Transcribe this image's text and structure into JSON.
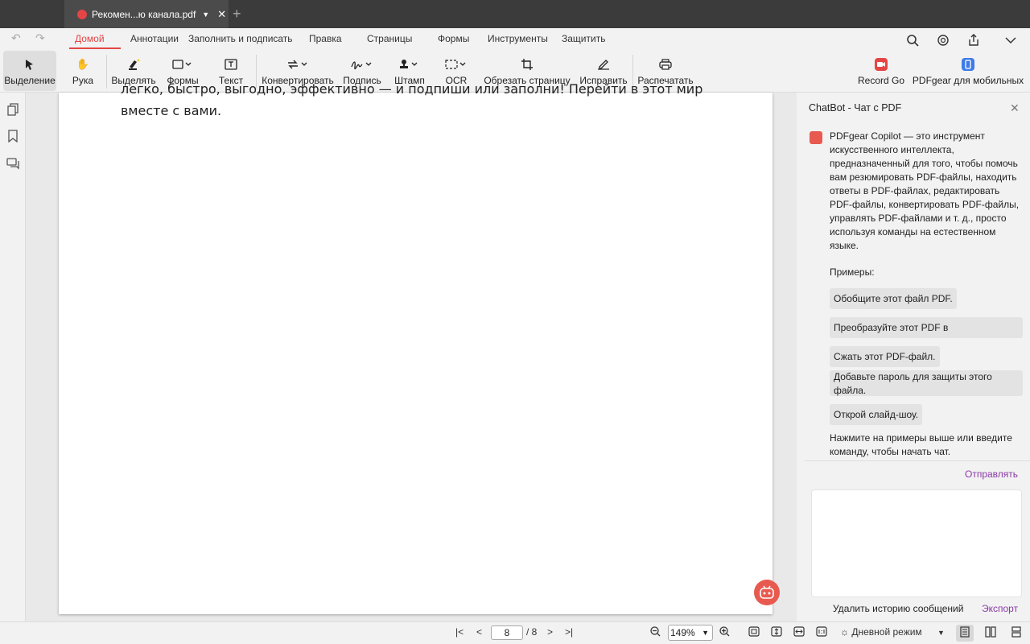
{
  "tab": {
    "title": "Рекомен...ю канала.pdf"
  },
  "menu": {
    "home": "Домой",
    "annotations": "Аннотации",
    "fill_sign": "Заполнить и подписать",
    "edit": "Правка",
    "pages": "Страницы",
    "forms": "Формы",
    "tools": "Инструменты",
    "protect": "Защитить"
  },
  "toolbar": {
    "select": "Выделение",
    "hand": "Рука",
    "highlight": "Выделять",
    "shapes": "Формы",
    "text": "Текст",
    "convert": "Конвертировать",
    "signature": "Подпись",
    "stamp": "Штамп",
    "ocr": "OCR",
    "crop": "Обрезать страницу",
    "fix": "Исправить",
    "print": "Распечатать",
    "record": "Record Go",
    "mobile": "PDFgear для мобильных"
  },
  "document": {
    "line_partial": "легко, быстро, выгодно, эффективно — и подпиши или заполни! Перейти в этот мир",
    "line_last": "вместе с вами."
  },
  "chat": {
    "title": "ChatBot - Чат с PDF",
    "intro": "PDFgear Copilot — это инструмент искусственного интеллекта, предназначенный для того, чтобы помочь вам резюмировать PDF-файлы, находить ответы в PDF-файлах, редактировать PDF-файлы, конвертировать PDF-файлы, управлять PDF-файлами и т. д., просто используя команды на естественном языке.",
    "examples_label": "Примеры:",
    "examples": [
      "Обобщите этот файл PDF.",
      "Преобразуйте этот PDF в",
      "Сжать этот PDF-файл.",
      "Добавьте пароль для защиты этого файла.",
      "Открой слайд-шоу."
    ],
    "hint": "Нажмите на примеры выше или введите команду, чтобы начать чат.",
    "send": "Отправлять",
    "clear_history": "Удалить историю сообщений",
    "export": "Экспорт"
  },
  "status": {
    "page_current": "8",
    "page_total": "/ 8",
    "zoom": "149%",
    "day_mode": "Дневной режим"
  },
  "colors": {
    "accent": "#e54545",
    "link": "#8a3aa6"
  }
}
